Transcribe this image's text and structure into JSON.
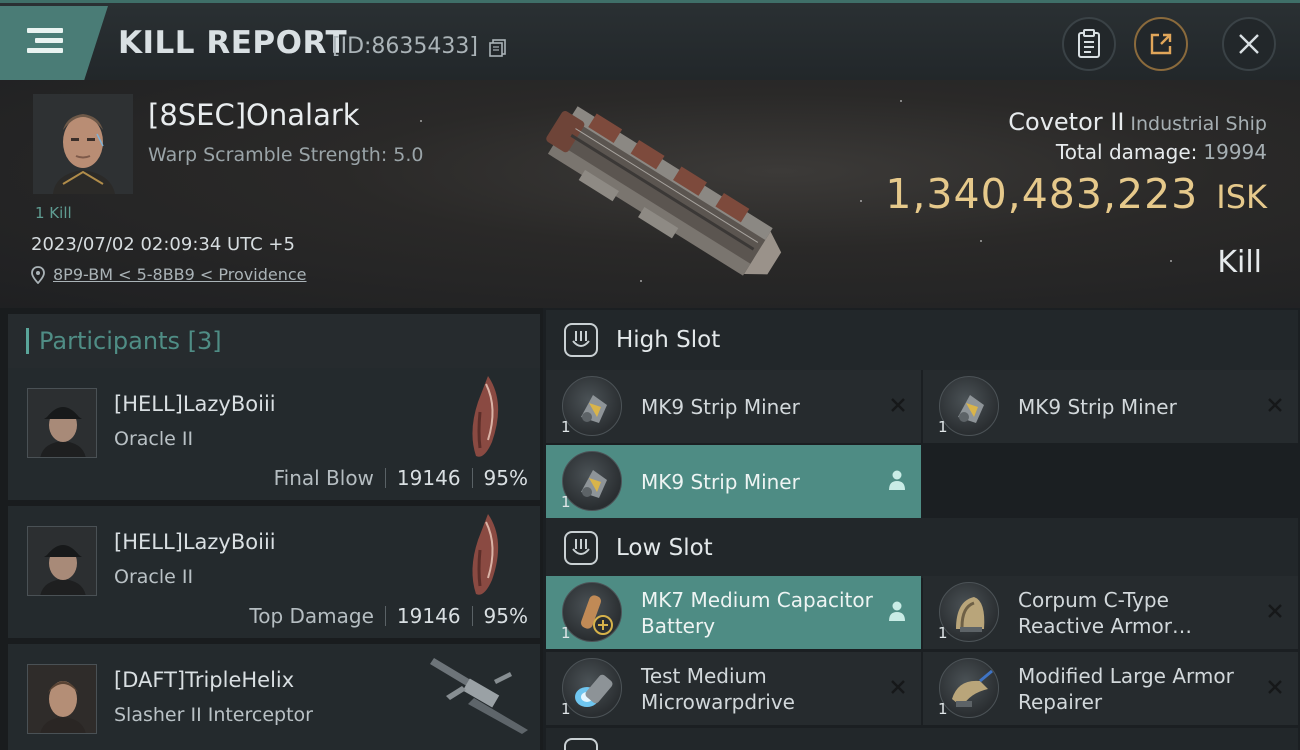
{
  "header": {
    "title": "KILL REPORT",
    "report_id": "[ID:8635433]",
    "icons": [
      "menu-icon",
      "copy-icon",
      "clipboard-icon",
      "share-icon",
      "close-icon"
    ]
  },
  "victim": {
    "name": "[8SEC]Onalark",
    "warp_scramble": "Warp Scramble Strength: 5.0",
    "kills": "1 Kill",
    "timestamp": "2023/07/02 02:09:34 UTC +5",
    "location": "8P9-BM < 5-8BB9 < Providence",
    "ship_name": "Covetor II",
    "ship_class": "Industrial Ship",
    "total_damage_label": "Total damage:",
    "total_damage": "19994",
    "isk_value": "1,340,483,223",
    "isk_unit": "ISK",
    "result": "Kill"
  },
  "participants": {
    "title": "Participants [3]",
    "items": [
      {
        "name": "[HELL]LazyBoiii",
        "ship": "Oracle II",
        "label": "Final Blow",
        "damage": "19146",
        "percent": "95%"
      },
      {
        "name": "[HELL]LazyBoiii",
        "ship": "Oracle II",
        "label": "Top Damage",
        "damage": "19146",
        "percent": "95%"
      },
      {
        "name": "[DAFT]TripleHelix",
        "ship": "Slasher II Interceptor"
      }
    ]
  },
  "fitting": {
    "high_slot": {
      "title": "High Slot",
      "modules": [
        {
          "name": "MK9 Strip Miner",
          "qty": "1"
        },
        {
          "name": "MK9 Strip Miner",
          "qty": "1"
        },
        {
          "name": "MK9 Strip Miner",
          "qty": "1"
        }
      ]
    },
    "low_slot": {
      "title": "Low Slot",
      "modules": [
        {
          "name": "MK7 Medium Capacitor Battery",
          "qty": "1"
        },
        {
          "name": "Corpum C-Type Reactive Armor…",
          "qty": "1"
        },
        {
          "name": "Test Medium Microwarpdrive",
          "qty": "1"
        },
        {
          "name": "Modified Large Armor Repairer",
          "qty": "1"
        }
      ]
    }
  },
  "colors": {
    "accent": "#4e8c84",
    "isk": "#e6c98b",
    "background": "#1b1f22"
  }
}
